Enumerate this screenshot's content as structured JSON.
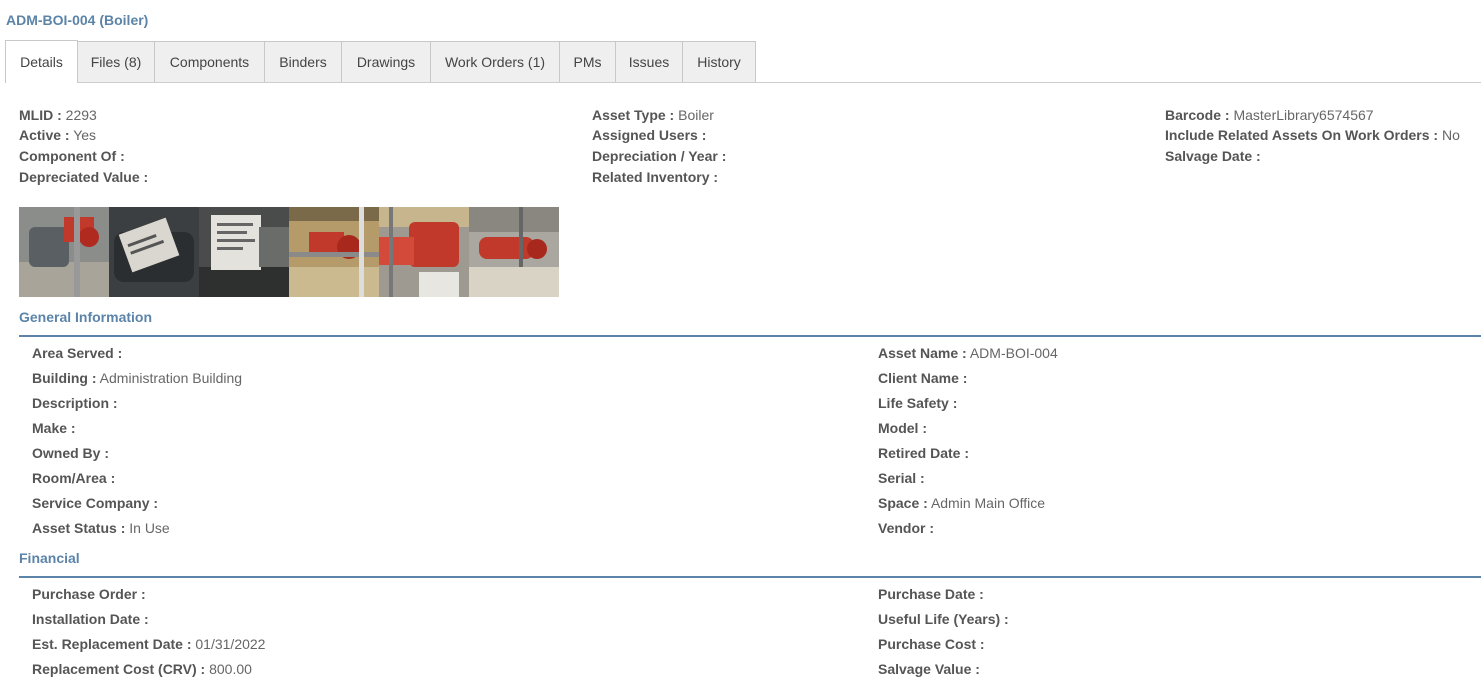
{
  "asset": {
    "title": "ADM-BOI-004 (Boiler)"
  },
  "tabs": [
    {
      "label": "Details",
      "active": true
    },
    {
      "label": "Files (8)"
    },
    {
      "label": "Components"
    },
    {
      "label": "Binders"
    },
    {
      "label": "Drawings"
    },
    {
      "label": "Work Orders (1)"
    },
    {
      "label": "PMs"
    },
    {
      "label": "Issues"
    },
    {
      "label": "History"
    }
  ],
  "summary": {
    "mlid": {
      "label": "MLID :",
      "value": "2293"
    },
    "active": {
      "label": "Active :",
      "value": "Yes"
    },
    "component_of": {
      "label": "Component Of :",
      "value": ""
    },
    "depreciated_value": {
      "label": "Depreciated Value :",
      "value": ""
    },
    "asset_type": {
      "label": "Asset Type :",
      "value": "Boiler"
    },
    "assigned_users": {
      "label": "Assigned Users :",
      "value": ""
    },
    "depreciation_year": {
      "label": "Depreciation / Year :",
      "value": ""
    },
    "related_inventory": {
      "label": "Related Inventory :",
      "value": ""
    },
    "barcode": {
      "label": "Barcode :",
      "value": "MasterLibrary6574567"
    },
    "include_related": {
      "label": "Include Related Assets On Work Orders :",
      "value": "No"
    },
    "salvage_date": {
      "label": "Salvage Date :",
      "value": ""
    }
  },
  "general": {
    "title": "General Information",
    "area_served": {
      "label": "Area Served :",
      "value": ""
    },
    "building": {
      "label": "Building :",
      "value": "Administration Building"
    },
    "description": {
      "label": "Description :",
      "value": ""
    },
    "make": {
      "label": "Make :",
      "value": ""
    },
    "owned_by": {
      "label": "Owned By :",
      "value": ""
    },
    "room_area": {
      "label": "Room/Area :",
      "value": ""
    },
    "service_company": {
      "label": "Service Company :",
      "value": ""
    },
    "asset_status": {
      "label": "Asset Status :",
      "value": "In Use"
    },
    "asset_name": {
      "label": "Asset Name :",
      "value": "ADM-BOI-004"
    },
    "client_name": {
      "label": "Client Name :",
      "value": ""
    },
    "life_safety": {
      "label": "Life Safety :",
      "value": ""
    },
    "model": {
      "label": "Model :",
      "value": ""
    },
    "retired_date": {
      "label": "Retired Date :",
      "value": ""
    },
    "serial": {
      "label": "Serial :",
      "value": ""
    },
    "space": {
      "label": "Space :",
      "value": "Admin Main Office"
    },
    "vendor": {
      "label": "Vendor :",
      "value": ""
    }
  },
  "financial": {
    "title": "Financial",
    "purchase_order": {
      "label": "Purchase Order :",
      "value": ""
    },
    "installation_date": {
      "label": "Installation Date :",
      "value": ""
    },
    "est_replacement_date": {
      "label": "Est. Replacement Date :",
      "value": "01/31/2022"
    },
    "replacement_cost": {
      "label": "Replacement Cost (CRV) :",
      "value": "800.00"
    },
    "purchase_date": {
      "label": "Purchase Date :",
      "value": ""
    },
    "useful_life": {
      "label": "Useful Life (Years) :",
      "value": ""
    },
    "purchase_cost": {
      "label": "Purchase Cost :",
      "value": ""
    },
    "salvage_value": {
      "label": "Salvage Value :",
      "value": ""
    }
  },
  "colors": {
    "accent": "#5b84a8",
    "tab_bg": "#efefef",
    "tab_border": "#c8c8c8",
    "label_text": "#555555"
  }
}
